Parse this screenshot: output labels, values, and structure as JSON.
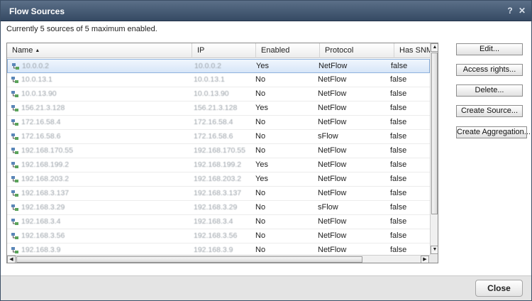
{
  "window": {
    "title": "Flow Sources",
    "help_label": "?",
    "close_label": "✕"
  },
  "status": {
    "text": "Currently 5 sources of 5 maximum enabled."
  },
  "table": {
    "columns": [
      {
        "label": "Name",
        "sorted": "ascending"
      },
      {
        "label": "IP"
      },
      {
        "label": "Enabled"
      },
      {
        "label": "Protocol"
      },
      {
        "label": "Has SNM"
      }
    ],
    "rows": [
      {
        "name": "10.0.0.2",
        "ip": "10.0.0.2",
        "enabled": "Yes",
        "protocol": "NetFlow",
        "snmp": "false",
        "selected": true
      },
      {
        "name": "10.0.13.1",
        "ip": "10.0.13.1",
        "enabled": "No",
        "protocol": "NetFlow",
        "snmp": "false"
      },
      {
        "name": "10.0.13.90",
        "ip": "10.0.13.90",
        "enabled": "No",
        "protocol": "NetFlow",
        "snmp": "false"
      },
      {
        "name": "156.21.3.128",
        "ip": "156.21.3.128",
        "enabled": "Yes",
        "protocol": "NetFlow",
        "snmp": "false"
      },
      {
        "name": "172.16.58.4",
        "ip": "172.16.58.4",
        "enabled": "No",
        "protocol": "NetFlow",
        "snmp": "false"
      },
      {
        "name": "172.16.58.6",
        "ip": "172.16.58.6",
        "enabled": "No",
        "protocol": "sFlow",
        "snmp": "false"
      },
      {
        "name": "192.168.170.55",
        "ip": "192.168.170.55",
        "enabled": "No",
        "protocol": "NetFlow",
        "snmp": "false"
      },
      {
        "name": "192.168.199.2",
        "ip": "192.168.199.2",
        "enabled": "Yes",
        "protocol": "NetFlow",
        "snmp": "false"
      },
      {
        "name": "192.168.203.2",
        "ip": "192.168.203.2",
        "enabled": "Yes",
        "protocol": "NetFlow",
        "snmp": "false"
      },
      {
        "name": "192.168.3.137",
        "ip": "192.168.3.137",
        "enabled": "No",
        "protocol": "NetFlow",
        "snmp": "false"
      },
      {
        "name": "192.168.3.29",
        "ip": "192.168.3.29",
        "enabled": "No",
        "protocol": "sFlow",
        "snmp": "false"
      },
      {
        "name": "192.168.3.4",
        "ip": "192.168.3.4",
        "enabled": "No",
        "protocol": "NetFlow",
        "snmp": "false"
      },
      {
        "name": "192.168.3.56",
        "ip": "192.168.3.56",
        "enabled": "No",
        "protocol": "NetFlow",
        "snmp": "false"
      },
      {
        "name": "192.168.3.9",
        "ip": "192.168.3.9",
        "enabled": "No",
        "protocol": "NetFlow",
        "snmp": "false"
      }
    ]
  },
  "actions": {
    "edit": "Edit...",
    "access_rights": "Access rights...",
    "delete": "Delete...",
    "create_source": "Create Source...",
    "create_aggregation": "Create Aggregation..."
  },
  "footer": {
    "close": "Close"
  },
  "icons": {
    "row": "network-source-icon",
    "sort": "sort-ascending-icon"
  },
  "colors": {
    "titlebar": "#4a5f79",
    "selection": "#d7e6f8",
    "selection_border": "#8fb2dd"
  }
}
